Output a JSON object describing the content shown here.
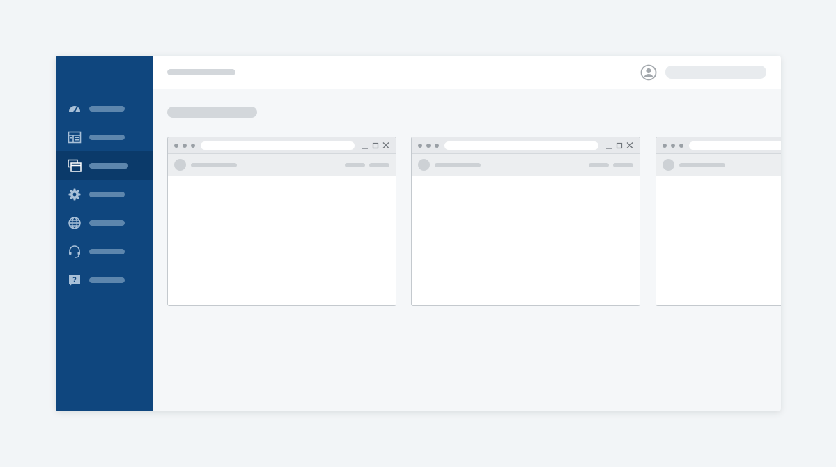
{
  "sidebar": {
    "background": "#0f467e",
    "active_background": "#0b3a6a",
    "items": [
      {
        "icon": "dashboard-gauge-icon",
        "active": false
      },
      {
        "icon": "layout-grid-icon",
        "active": false
      },
      {
        "icon": "windows-stack-icon",
        "active": true
      },
      {
        "icon": "gear-icon",
        "active": false
      },
      {
        "icon": "globe-icon",
        "active": false
      },
      {
        "icon": "headset-icon",
        "active": false
      },
      {
        "icon": "help-chat-icon",
        "active": false
      }
    ]
  },
  "header": {
    "title": "",
    "user_icon": "user-avatar-icon",
    "user_name": ""
  },
  "main": {
    "heading": "",
    "windows": [
      {
        "title": "",
        "url": "",
        "controls": [
          "minimize-icon",
          "maximize-icon",
          "close-icon"
        ]
      },
      {
        "title": "",
        "url": "",
        "controls": [
          "minimize-icon",
          "maximize-icon",
          "close-icon"
        ]
      },
      {
        "title": "",
        "url": ""
      }
    ]
  }
}
